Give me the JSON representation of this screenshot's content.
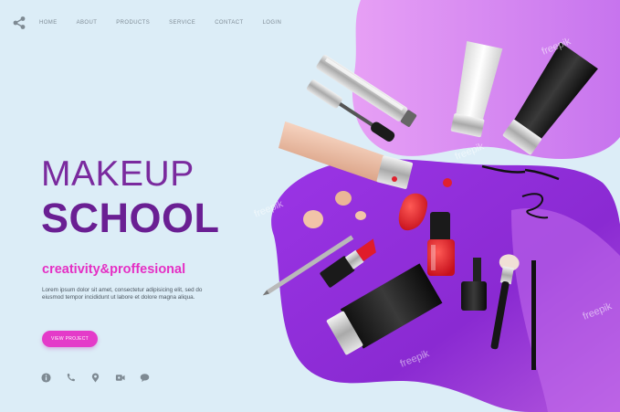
{
  "nav": {
    "share_icon": "share-icon",
    "items": [
      "HOME",
      "ABOUT",
      "PRODUCTS",
      "SERVICE",
      "CONTACT",
      "LOGIN"
    ]
  },
  "hero": {
    "title_line1": "MAKEUP",
    "title_line2": "SCHOOL",
    "tagline": "creativity&proffesional",
    "description": "Lorem ipsum dolor sit amet, consectetur adipisicing elit, sed do eiusmod tempor incididunt ut labore et dolore magna aliqua.",
    "cta_label": "VIEW PROJECT"
  },
  "contact_icons": [
    "info-icon",
    "phone-icon",
    "location-icon",
    "video-icon",
    "chat-icon"
  ],
  "watermark": "freepik",
  "colors": {
    "background": "#dcedf7",
    "title": "#7a2a9e",
    "accent_pink": "#e43bc9",
    "blob_purple": "#8a2fd6",
    "blob_pink": "#d88cf0"
  }
}
